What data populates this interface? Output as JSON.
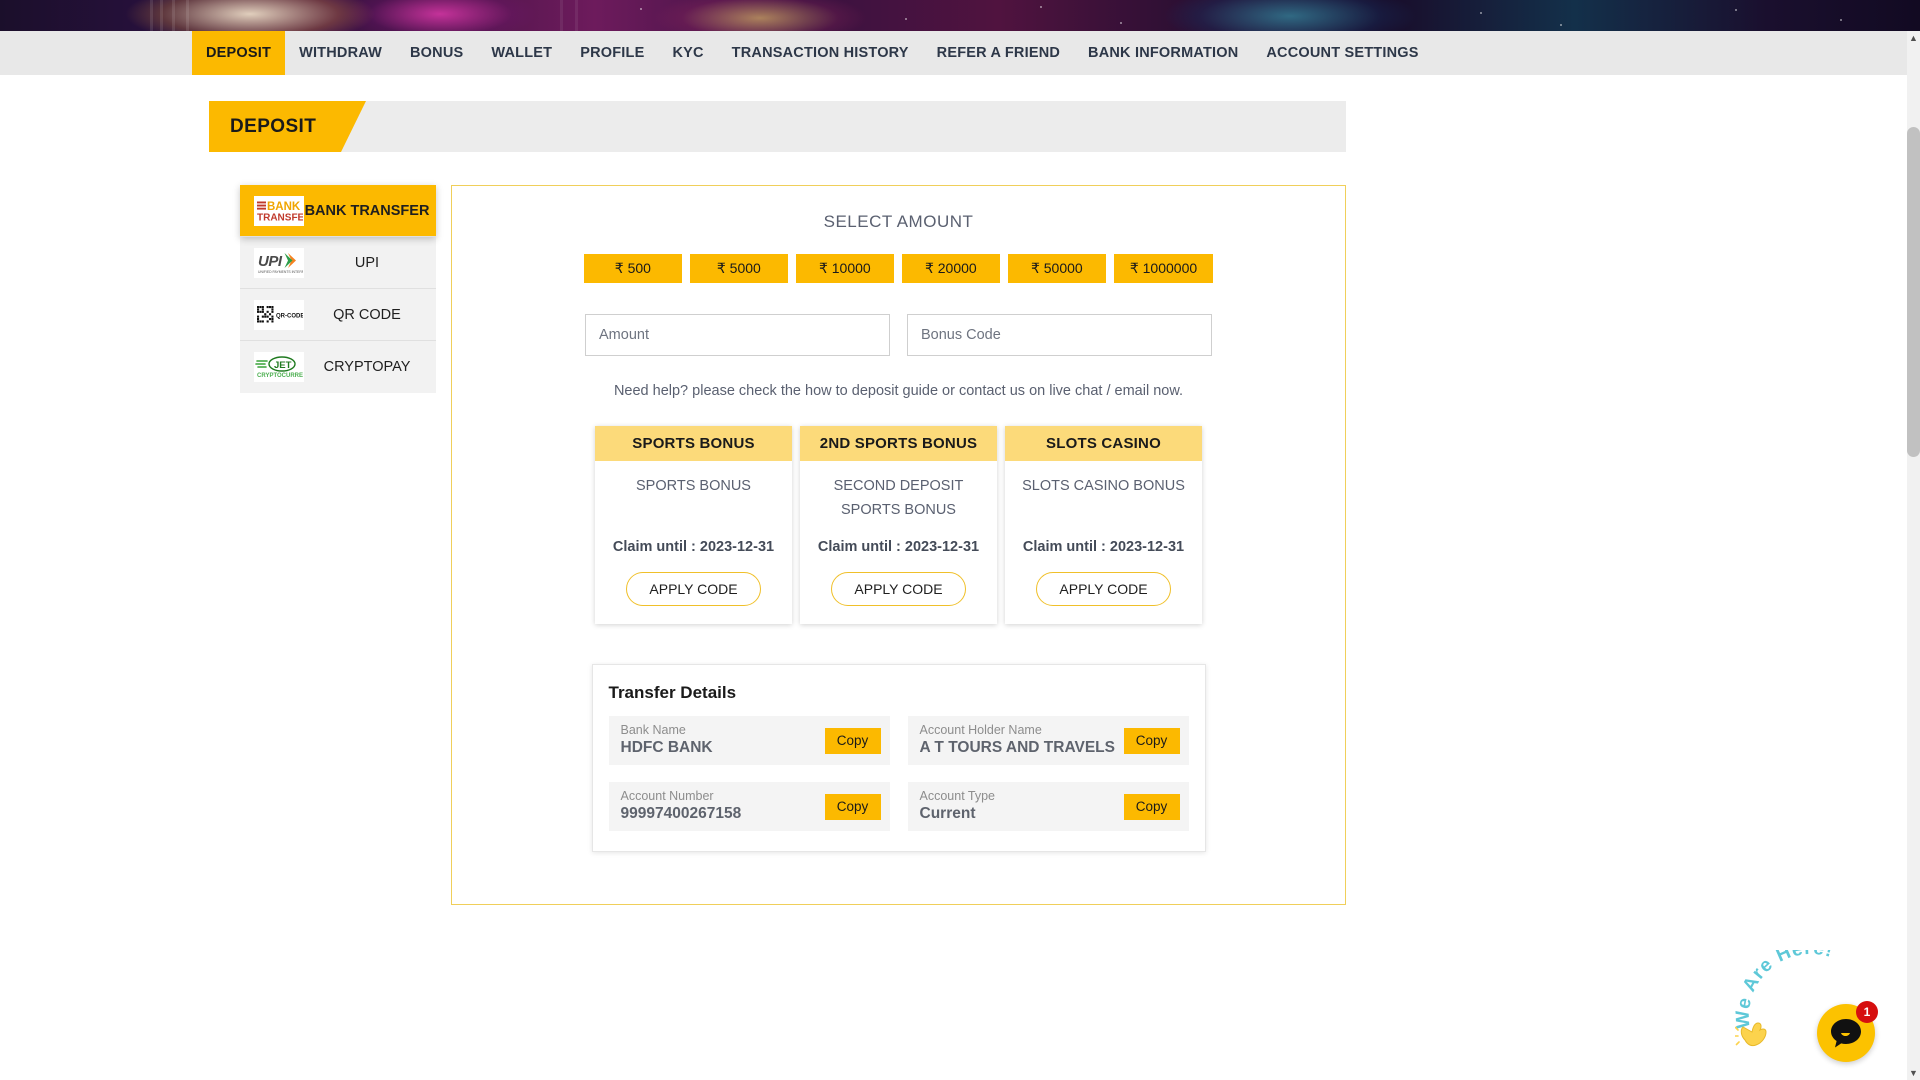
{
  "nav": {
    "items": [
      {
        "label": "DEPOSIT",
        "active": true
      },
      {
        "label": "WITHDRAW",
        "active": false
      },
      {
        "label": "BONUS",
        "active": false
      },
      {
        "label": "WALLET",
        "active": false
      },
      {
        "label": "PROFILE",
        "active": false
      },
      {
        "label": "KYC",
        "active": false
      },
      {
        "label": "TRANSACTION HISTORY",
        "active": false
      },
      {
        "label": "REFER A FRIEND",
        "active": false
      },
      {
        "label": "BANK INFORMATION",
        "active": false
      },
      {
        "label": "ACCOUNT SETTINGS",
        "active": false
      }
    ]
  },
  "page": {
    "title": "DEPOSIT"
  },
  "methods": [
    {
      "label": "BANK TRANSFER",
      "icon": "bank-transfer-logo",
      "active": true
    },
    {
      "label": "UPI",
      "icon": "upi-logo",
      "active": false
    },
    {
      "label": "QR CODE",
      "icon": "qr-code-logo",
      "active": false
    },
    {
      "label": "CRYPTOPAY",
      "icon": "jet-cryptocurrency-logo",
      "active": false
    }
  ],
  "deposit": {
    "select_amount_title": "SELECT AMOUNT",
    "currency_symbol": "₹",
    "amounts": [
      {
        "label": "₹ 500",
        "value": 500
      },
      {
        "label": "₹ 5000",
        "value": 5000
      },
      {
        "label": "₹ 10000",
        "value": 10000
      },
      {
        "label": "₹ 20000",
        "value": 20000
      },
      {
        "label": "₹ 50000",
        "value": 50000
      },
      {
        "label": "₹ 1000000",
        "value": 1000000
      }
    ],
    "amount_input": {
      "placeholder": "Amount",
      "value": ""
    },
    "bonus_input": {
      "placeholder": "Bonus Code",
      "value": ""
    },
    "help_text": "Need help? please check the how to deposit guide or contact us on live chat / email now."
  },
  "bonuses": [
    {
      "title": "SPORTS BONUS",
      "description": "SPORTS BONUS",
      "claim_until": "Claim until : 2023-12-31",
      "apply_label": "APPLY CODE",
      "featured": false
    },
    {
      "title": "2ND SPORTS BONUS",
      "description": "SECOND DEPOSIT SPORTS BONUS",
      "claim_until": "Claim until : 2023-12-31",
      "apply_label": "APPLY CODE",
      "featured": true
    },
    {
      "title": "SLOTS CASINO",
      "description": "SLOTS CASINO BONUS",
      "claim_until": "Claim until : 2023-12-31",
      "apply_label": "APPLY CODE",
      "featured": false
    }
  ],
  "transfer_details": {
    "title": "Transfer Details",
    "copy_label": "Copy",
    "fields": [
      {
        "label": "Bank Name",
        "value": "HDFC BANK"
      },
      {
        "label": "Account Holder Name",
        "value": "A T TOURS AND TRAVELS"
      },
      {
        "label": "Account Number",
        "value": "99997400267158"
      },
      {
        "label": "Account Type",
        "value": "Current"
      }
    ]
  },
  "chat_widget": {
    "greeting": "We Are Here!",
    "badge_count": "1",
    "icon": "chat-bubble-icon"
  },
  "colors": {
    "brand_yellow": "#fcb900",
    "bonus_head": "#fcda7a",
    "nav_bg": "#e8e8e8",
    "badge_red": "#d60f0f"
  }
}
